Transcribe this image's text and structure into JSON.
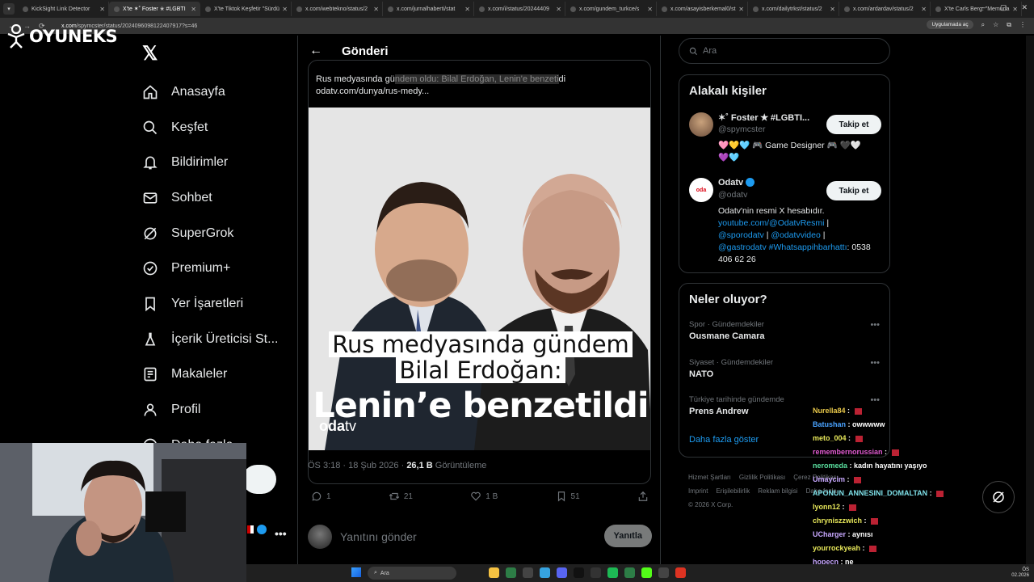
{
  "browser": {
    "tabs": [
      {
        "label": "KickSight Link Detector",
        "active": false
      },
      {
        "label": "X'te ✶˚ Foster ✭ #LGBTI",
        "active": true
      },
      {
        "label": "X'te Tiktok Keşfetir \"Sürdü",
        "active": false
      },
      {
        "label": "x.com/webtekno/status/2",
        "active": false
      },
      {
        "label": "x.com/jurnalhaberti/stat",
        "active": false
      },
      {
        "label": "x.com/i/status/20244409",
        "active": false
      },
      {
        "label": "x.com/gundem_turkce/s",
        "active": false
      },
      {
        "label": "x.com/asayisberkemal0/st",
        "active": false
      },
      {
        "label": "x.com/dailytrkst/status/2",
        "active": false
      },
      {
        "label": "x.com/ardardav/status/2",
        "active": false
      },
      {
        "label": "X'te Carls Berg: \"Memurla",
        "active": false
      }
    ],
    "url_domain": "x.com",
    "url_path": "/spymcster/status/2024096098122407917?s=46",
    "app_button": "Uygulamada aç"
  },
  "stream_logo": "OYUNEKS",
  "nav": {
    "items": [
      {
        "label": "Anasayfa",
        "icon": "home-icon"
      },
      {
        "label": "Keşfet",
        "icon": "search-icon"
      },
      {
        "label": "Bildirimler",
        "icon": "bell-icon"
      },
      {
        "label": "Sohbet",
        "icon": "mail-icon"
      },
      {
        "label": "SuperGrok",
        "icon": "grok-icon"
      },
      {
        "label": "Premium+",
        "icon": "verified-icon"
      },
      {
        "label": "Yer İşaretleri",
        "icon": "bookmark-icon"
      },
      {
        "label": "İçerik Üreticisi St...",
        "icon": "flask-icon"
      },
      {
        "label": "Makaleler",
        "icon": "article-icon"
      },
      {
        "label": "Profil",
        "icon": "person-icon"
      },
      {
        "label": "Daha fazla",
        "icon": "more-icon"
      }
    ]
  },
  "post": {
    "header_title": "Gönderi",
    "quote_text_pre": "Rus medyasında gü",
    "quote_text_hl": "ndem oldu: Bilal Erdoğan, Lenin'e benzeti",
    "quote_text_post": "di",
    "quote_link": "odatv.com/dunya/rus-medy...",
    "media_caption_1": "Rus medyasında gündem",
    "media_caption_2": "Bilal Erdoğan:",
    "media_caption_3": "Lenin’e benzetildi",
    "media_brand_a": "oda",
    "media_brand_b": "tv",
    "time": "ÖS 3:18 · 18 Şub 2026 ·",
    "views_count": "26,1 B",
    "views_label": "Görüntüleme",
    "replies": "1",
    "reposts": "21",
    "likes": "1 B",
    "bookmarks": "51",
    "reply_placeholder": "Yanıtını gönder",
    "reply_button": "Yanıtla"
  },
  "right": {
    "search_placeholder": "Ara",
    "related_title": "Alakalı kişiler",
    "people": [
      {
        "name": "✶˚ Foster ✭ #LGBTI...",
        "handle": "@spymcster",
        "bio": "🩷💛🩵 🎮 Game Designer 🎮 🖤🤍 💜🩵",
        "follow": "Takip et"
      },
      {
        "name": "Odatv",
        "handle": "@odatv",
        "bio_text": "Odatv'nin resmi X hesabıdır.",
        "bio_link1": "youtube.com/@OdatvResmi",
        "bio_sep1": " | ",
        "bio_link2": "@sporodatv",
        "bio_sep2": " | ",
        "bio_link3": "@odatvvideo",
        "bio_sep3": " | ",
        "bio_link4": "@gastrodatv",
        "bio_link5": "#Whatsappihbarhattı",
        "bio_phone": ": 0538 406 62 26",
        "follow": "Takip et"
      }
    ],
    "trends_title": "Neler oluyor?",
    "trends": [
      {
        "category": "Spor · Gündemdekiler",
        "name": "Ousmane Camara"
      },
      {
        "category": "Siyaset · Gündemdekiler",
        "name": "NATO"
      },
      {
        "category": "Türkiye tarihinde gündemde",
        "name": "Prens Andrew"
      }
    ],
    "show_more": "Daha fazla göster",
    "footer": [
      "Hizmet Şartları",
      "Gizlilik Politikası",
      "Çerez Politikası",
      "Imprint",
      "Erişilebilirlik",
      "Reklam bilgisi",
      "Daha fazla",
      "© 2026 X Corp."
    ]
  },
  "chat": [
    {
      "user": "Nurella84",
      "msg": "",
      "color": "#e8c84a"
    },
    {
      "user": "Batushan",
      "msg": "owwwww",
      "color": "#4aa3ff"
    },
    {
      "user": "meto_004",
      "msg": "",
      "color": "#e8e85a"
    },
    {
      "user": "remembernorussian",
      "msg": "",
      "color": "#e05ad0"
    },
    {
      "user": "neromeda",
      "msg": "kadın hayatını yaşıyo",
      "color": "#5ae0a0"
    },
    {
      "user": "Umaycim",
      "msg": "",
      "color": "#c8a8ff"
    },
    {
      "user": "APONUN_ANNESINI_DOMALTAN",
      "msg": "",
      "color": "#7ee0e8"
    },
    {
      "user": "lyonn12",
      "msg": "",
      "color": "#e8e85a"
    },
    {
      "user": "chryniszzwich",
      "msg": "",
      "color": "#e8e85a"
    },
    {
      "user": "UCharger",
      "msg": "aynısı",
      "color": "#c8a8ff"
    },
    {
      "user": "yourrockyeah",
      "msg": "",
      "color": "#e8e85a"
    },
    {
      "user": "hopecn",
      "msg": "ne",
      "color": "#c8a8ff"
    }
  ],
  "taskbar": {
    "search": "Ara",
    "time": "ÖS",
    "date": "02.2026"
  },
  "colors": {
    "accent": "#1d9bf0",
    "background": "#000000",
    "border": "#2f3336",
    "muted": "#71767b"
  }
}
